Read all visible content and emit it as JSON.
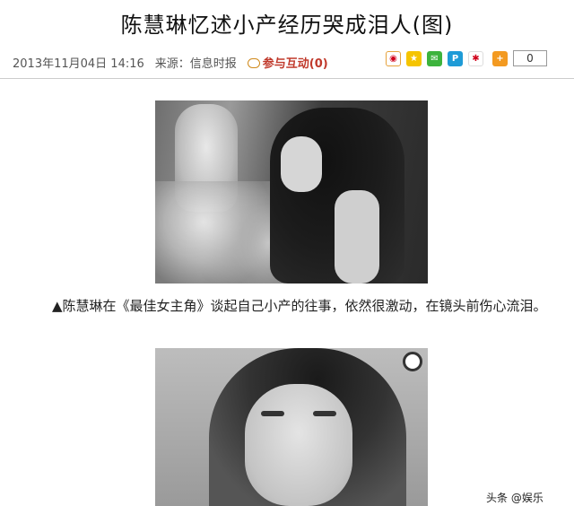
{
  "article": {
    "title": "陈慧琳忆述小产经历哭成泪人(图)",
    "date": "2013年11月04日 14:16",
    "source_label": "来源：",
    "source": "信息时报",
    "interact_label": "参与互动(0)"
  },
  "share": {
    "icons": [
      "weibo-icon",
      "qzone-icon",
      "qq-icon",
      "pengyou-icon",
      "renren-icon",
      "more-plus-icon"
    ],
    "count": "0"
  },
  "caption": "▲陈慧琳在《最佳女主角》谈起自己小产的往事，依然很激动，在镜头前伤心流泪。",
  "watermark": "头条 @娱乐"
}
